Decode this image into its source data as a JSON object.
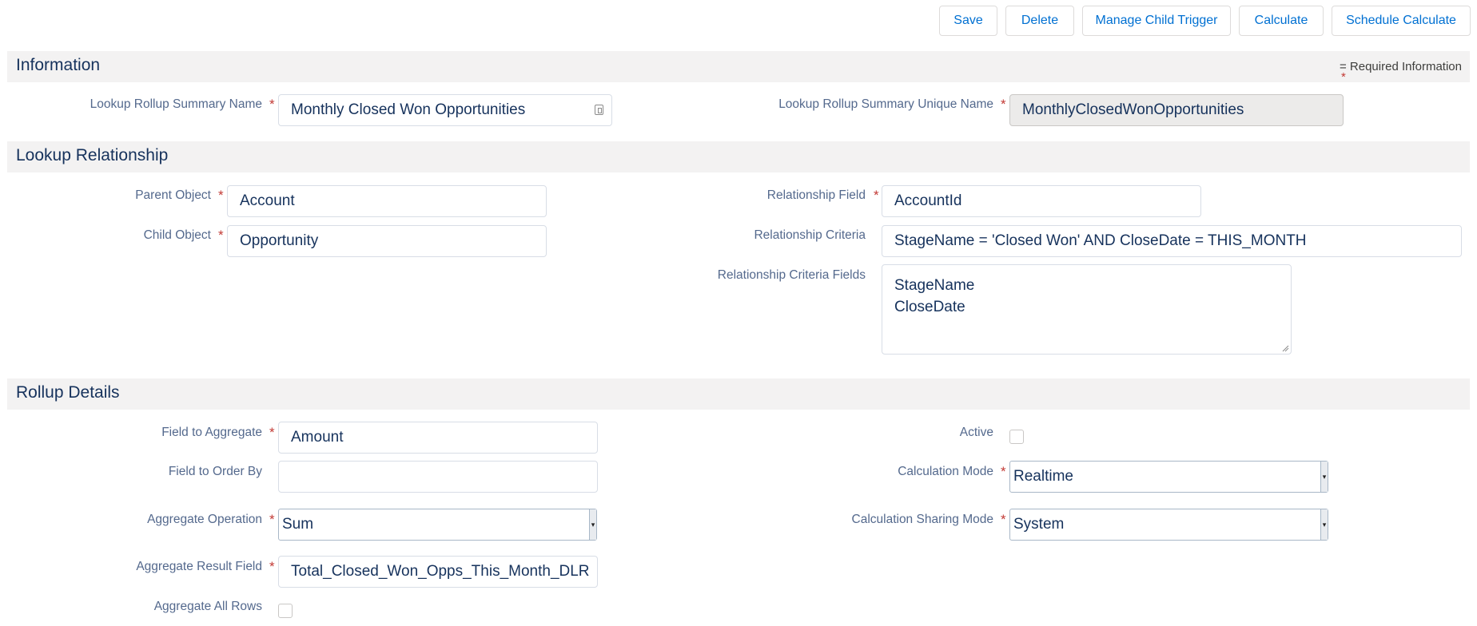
{
  "toolbar": {
    "save": "Save",
    "delete": "Delete",
    "manage_child_trigger": "Manage Child Trigger",
    "calculate": "Calculate",
    "schedule_calculate": "Schedule Calculate"
  },
  "sections": {
    "information": "Information",
    "lookup_relationship": "Lookup Relationship",
    "rollup_details": "Rollup Details"
  },
  "required_info": {
    "star": "*",
    "text": "= Required Information"
  },
  "information": {
    "summary_name_label": "Lookup Rollup Summary Name",
    "summary_name_value": "Monthly Closed Won Opportunities",
    "unique_name_label": "Lookup Rollup Summary Unique Name",
    "unique_name_value": "MonthlyClosedWonOpportunities"
  },
  "lookup": {
    "parent_object_label": "Parent Object",
    "parent_object_value": "Account",
    "child_object_label": "Child Object",
    "child_object_value": "Opportunity",
    "relationship_field_label": "Relationship Field",
    "relationship_field_value": "AccountId",
    "relationship_criteria_label": "Relationship Criteria",
    "relationship_criteria_value": "StageName = 'Closed Won' AND CloseDate = THIS_MONTH",
    "criteria_fields_label": "Relationship Criteria Fields",
    "criteria_fields_lines": [
      "StageName",
      "CloseDate"
    ]
  },
  "rollup": {
    "field_to_aggregate_label": "Field to Aggregate",
    "field_to_aggregate_value": "Amount",
    "field_to_order_by_label": "Field to Order By",
    "field_to_order_by_value": "",
    "aggregate_operation_label": "Aggregate Operation",
    "aggregate_operation_value": "Sum",
    "aggregate_result_field_label": "Aggregate Result Field",
    "aggregate_result_field_value": "Total_Closed_Won_Opps_This_Month_DLR",
    "aggregate_all_rows_label": "Aggregate All Rows",
    "aggregate_all_rows_checked": false,
    "active_label": "Active",
    "active_checked": false,
    "calculation_mode_label": "Calculation Mode",
    "calculation_mode_value": "Realtime",
    "calculation_sharing_mode_label": "Calculation Sharing Mode",
    "calculation_sharing_mode_value": "System"
  },
  "colors": {
    "link_blue": "#0070d2",
    "required_red": "#c23934",
    "section_bg": "#f3f2f2"
  }
}
